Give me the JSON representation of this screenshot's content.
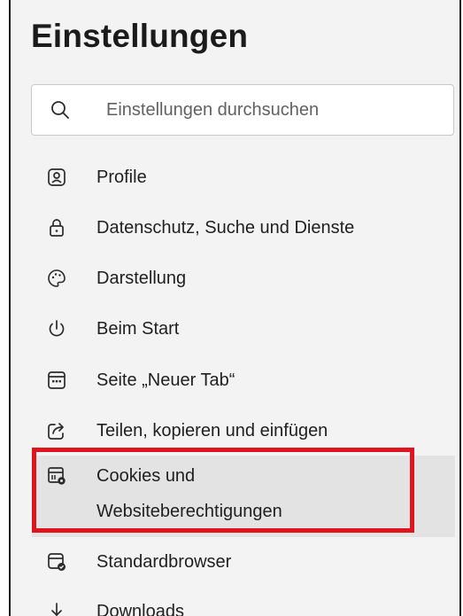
{
  "header": {
    "title": "Einstellungen"
  },
  "search": {
    "placeholder": "Einstellungen durchsuchen",
    "icon": "search-icon"
  },
  "nav": {
    "items": [
      {
        "label": "Profile",
        "icon": "profile-icon"
      },
      {
        "label": "Datenschutz, Suche und Dienste",
        "icon": "lock-icon"
      },
      {
        "label": "Darstellung",
        "icon": "palette-icon"
      },
      {
        "label": "Beim Start",
        "icon": "power-icon"
      },
      {
        "label": "Seite „Neuer Tab“",
        "icon": "new-tab-page-icon"
      },
      {
        "label": "Teilen, kopieren und einfügen",
        "icon": "share-icon"
      },
      {
        "label_line1": "Cookies und",
        "label_line2": "Websiteberechtigungen",
        "icon": "site-permissions-icon",
        "active": true
      },
      {
        "label": "Standardbrowser",
        "icon": "default-browser-icon"
      },
      {
        "label": "Downloads",
        "icon": "download-icon"
      }
    ]
  },
  "colors": {
    "accent": "#0f6cbd",
    "highlight": "#e0141e",
    "active_bg": "#e3e3e3",
    "panel_bg": "#f3f3f3"
  }
}
